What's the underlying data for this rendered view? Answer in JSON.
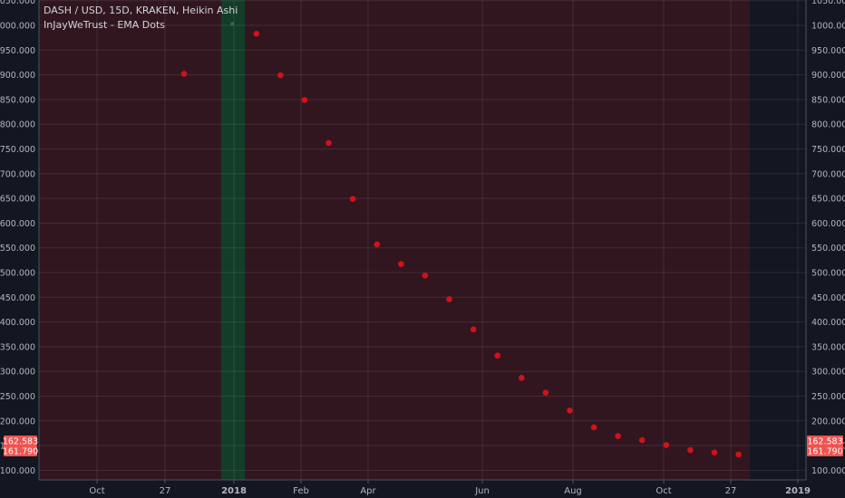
{
  "chart_data": {
    "type": "scatter",
    "title": "DASH / USD, 15D, KRAKEN, Heikin Ashi",
    "subtitle": "InJayWeTrust - EMA Dots",
    "xlabel": "",
    "ylabel": "",
    "ylim": [
      65,
      1055
    ],
    "x_tick_labels": [
      "Oct",
      "27",
      "2018",
      "Feb",
      "Apr",
      "Jun",
      "Aug",
      "Oct",
      "27",
      "2019"
    ],
    "y_tick_labels": [
      "1050.000",
      "1000.000",
      "950.000",
      "900.000",
      "850.000",
      "800.000",
      "750.000",
      "700.000",
      "650.000",
      "600.000",
      "550.000",
      "500.000",
      "450.000",
      "400.000",
      "350.000",
      "300.000",
      "250.000",
      "200.000",
      "150.000",
      "100.000"
    ],
    "series": [
      {
        "color": "#d0121b",
        "points": [
          {
            "x": "2017-12-01",
            "y": 902
          },
          {
            "x": "2017-12-31",
            "y": 1003
          },
          {
            "x": "2018-01-15",
            "y": 983
          },
          {
            "x": "2018-01-30",
            "y": 899
          },
          {
            "x": "2018-02-14",
            "y": 849
          },
          {
            "x": "2018-03-01",
            "y": 762
          },
          {
            "x": "2018-03-16",
            "y": 649
          },
          {
            "x": "2018-03-31",
            "y": 557
          },
          {
            "x": "2018-04-15",
            "y": 517
          },
          {
            "x": "2018-04-30",
            "y": 494
          },
          {
            "x": "2018-05-15",
            "y": 446
          },
          {
            "x": "2018-05-30",
            "y": 385
          },
          {
            "x": "2018-06-14",
            "y": 332
          },
          {
            "x": "2018-06-29",
            "y": 287
          },
          {
            "x": "2018-07-14",
            "y": 257
          },
          {
            "x": "2018-07-29",
            "y": 221
          },
          {
            "x": "2018-08-13",
            "y": 187
          },
          {
            "x": "2018-08-28",
            "y": 169
          },
          {
            "x": "2018-09-12",
            "y": 161
          },
          {
            "x": "2018-09-27",
            "y": 151
          },
          {
            "x": "2018-10-12",
            "y": 141
          },
          {
            "x": "2018-10-27",
            "y": 136
          },
          {
            "x": "2018-11-11",
            "y": 132
          }
        ]
      }
    ],
    "background_regions": [
      {
        "from": "2017-08-01",
        "to": "2017-12-24",
        "color": "#311620"
      },
      {
        "from": "2017-12-24",
        "to": "2018-01-08",
        "color": "#143d27"
      },
      {
        "from": "2018-01-08",
        "to": "2018-11-18",
        "color": "#311620"
      }
    ],
    "price_labels": [
      {
        "label": "162.583",
        "value": 162.583,
        "color": "#ef5350"
      },
      {
        "label": "161.790",
        "value": 161.79,
        "color": "#ef5350"
      }
    ],
    "grid": true,
    "legend": "top-left",
    "y_axis": "both sides"
  }
}
